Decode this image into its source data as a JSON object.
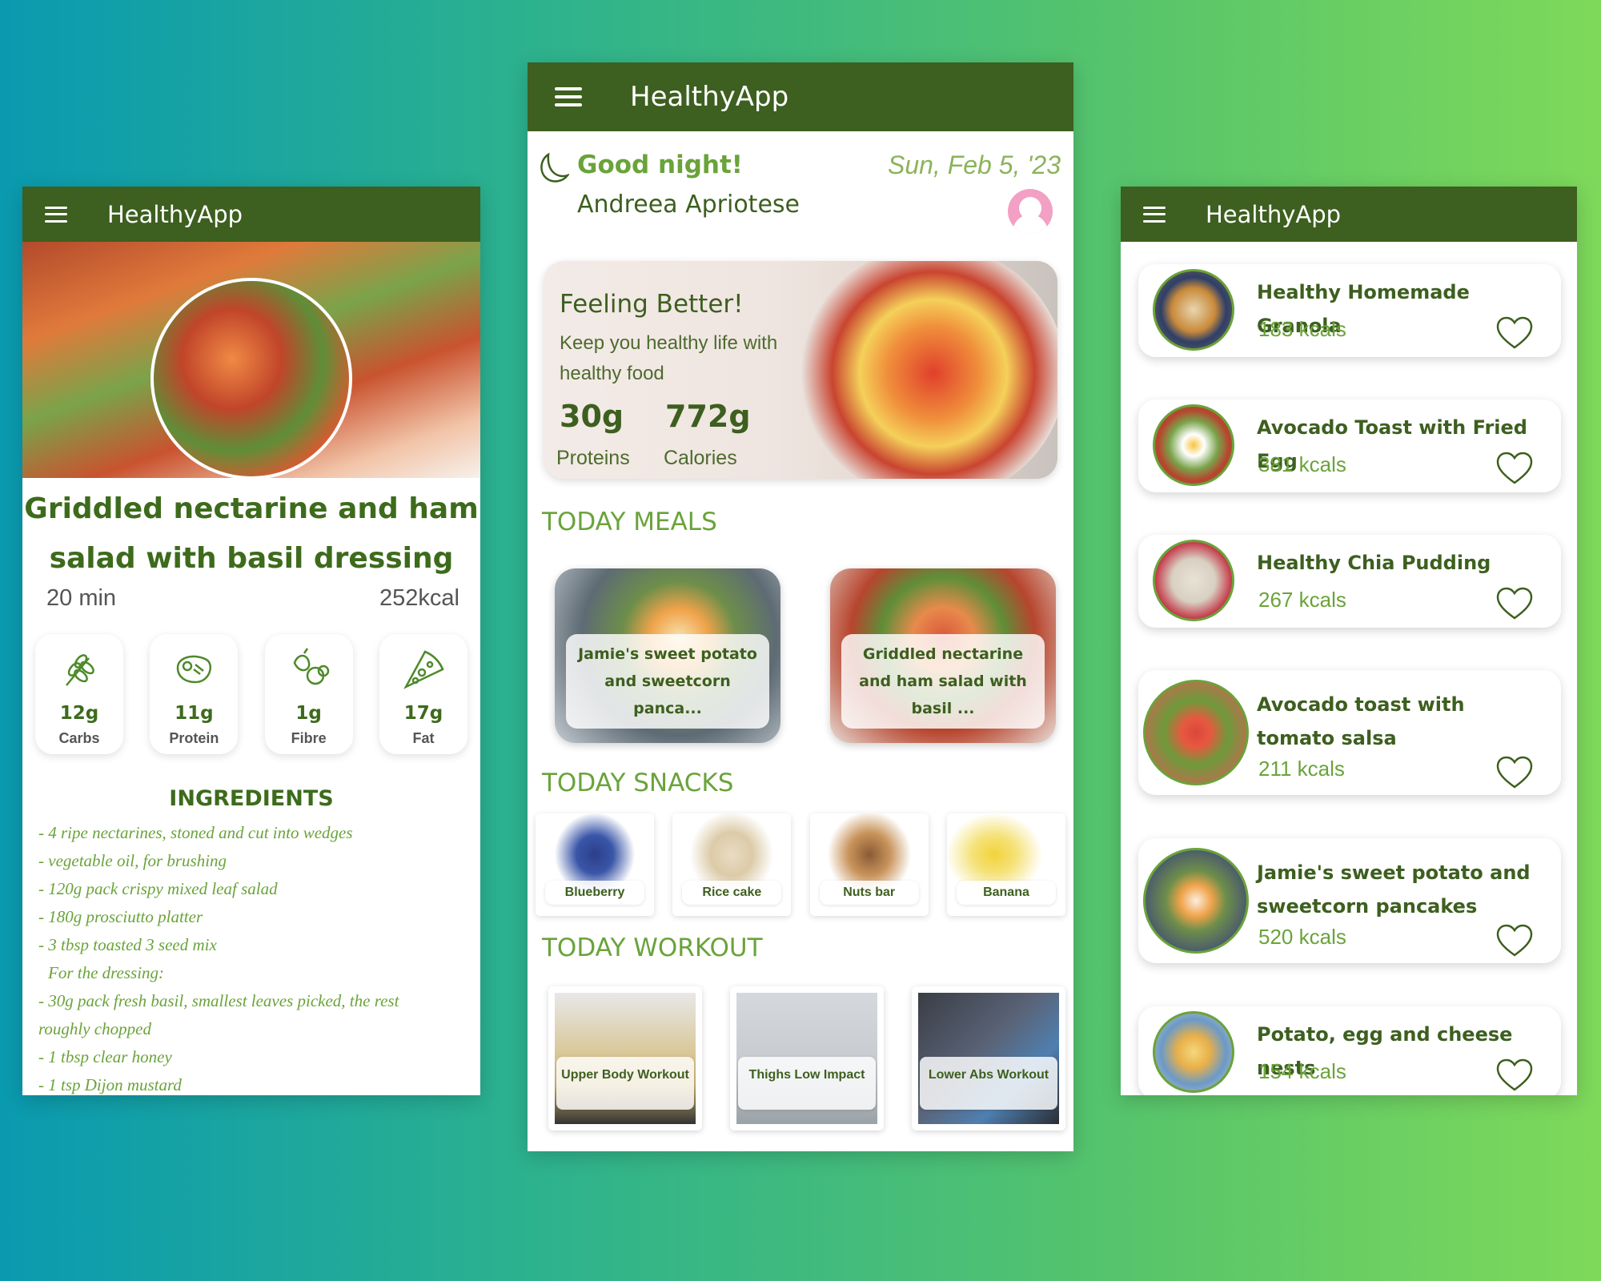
{
  "app": {
    "title": "HealthyApp"
  },
  "detail": {
    "title": "Griddled nectarine and ham salad with basil dressing",
    "time": "20 min",
    "kcal": "252",
    "kcal_unit": "kcal",
    "nutrients": [
      {
        "value": "12g",
        "label": "Carbs",
        "icon": "wheat-icon"
      },
      {
        "value": "11g",
        "label": "Protein",
        "icon": "steak-icon"
      },
      {
        "value": "1g",
        "label": "Fibre",
        "icon": "fruit-icon"
      },
      {
        "value": "17g",
        "label": "Fat",
        "icon": "pizza-icon"
      }
    ],
    "ingredients_heading": "INGREDIENTS",
    "ingredients": [
      "- 4 ripe nectarines, stoned and cut into wedges",
      "- vegetable oil, for brushing",
      "- 120g pack crispy mixed leaf salad",
      "- 180g prosciutto platter",
      "- 3 tbsp toasted 3 seed mix",
      "For the dressing:",
      "- 30g pack fresh basil, smallest leaves picked, the rest",
      "roughly chopped",
      "- 1 tbsp clear honey",
      "- 1 tsp Dijon mustard"
    ]
  },
  "home": {
    "greeting": "Good night!",
    "date": "Sun, Feb 5, '23",
    "user": "Andreea Apriotese",
    "promo": {
      "title": "Feeling Better!",
      "subtitle": "Keep you healthy life with healthy food",
      "proteins_value": "30g",
      "proteins_label": "Proteins",
      "calories_value": "772g",
      "calories_label": "Calories"
    },
    "meals_heading": "TODAY MEALS",
    "meals": [
      {
        "label": "Jamie's sweet potato and sweetcorn panca..."
      },
      {
        "label": "Griddled nectarine and ham salad with basil ..."
      }
    ],
    "snacks_heading": "TODAY SNACKS",
    "snacks": [
      {
        "label": "Blueberry"
      },
      {
        "label": "Rice cake"
      },
      {
        "label": "Nuts bar"
      },
      {
        "label": "Banana"
      }
    ],
    "workout_heading": "TODAY WORKOUT",
    "workouts": [
      {
        "label": "Upper Body Workout"
      },
      {
        "label": "Thighs Low Impact"
      },
      {
        "label": "Lower Abs Workout"
      }
    ]
  },
  "recipes": [
    {
      "name": "Healthy Homemade Granola",
      "kcal": "183  kcals"
    },
    {
      "name": "Avocado Toast with Fried Egg",
      "kcal": "381  kcals"
    },
    {
      "name": "Healthy Chia Pudding",
      "kcal": "267  kcals"
    },
    {
      "name": "Avocado toast with tomato salsa",
      "kcal": "211  kcals"
    },
    {
      "name": "Jamie's sweet potato and sweetcorn pancakes",
      "kcal": "520  kcals"
    },
    {
      "name": "Potato, egg and cheese nests",
      "kcal": "154  kcals"
    }
  ],
  "colors": {
    "appbar": "#3d5f1f",
    "accent": "#6aa33a",
    "dark_text": "#3d6b1c"
  }
}
